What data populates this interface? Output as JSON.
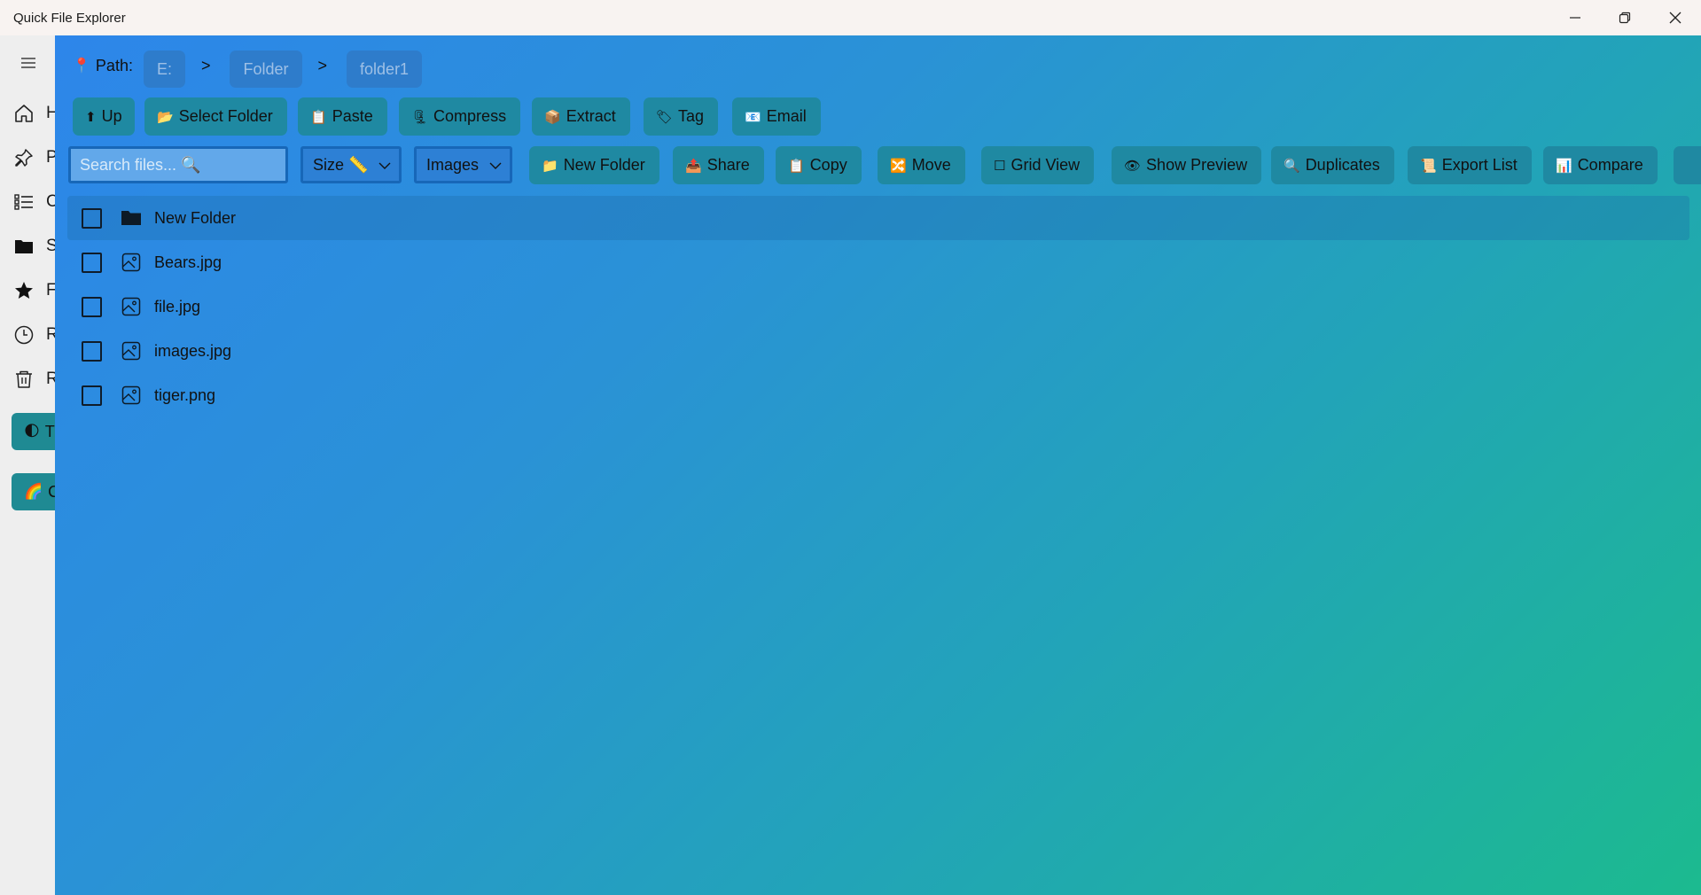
{
  "window": {
    "title": "Quick File Explorer"
  },
  "sidebar": {
    "items": [
      {
        "label": "H",
        "icon": "home-icon"
      },
      {
        "label": "P",
        "icon": "pin-icon"
      },
      {
        "label": "C",
        "icon": "list-icon"
      },
      {
        "label": "S",
        "icon": "folder-icon"
      },
      {
        "label": "F",
        "icon": "star-icon"
      },
      {
        "label": "R",
        "icon": "clock-icon"
      },
      {
        "label": "R",
        "icon": "trash-icon"
      }
    ],
    "pills": [
      {
        "emoji": "🌓",
        "label": "T"
      },
      {
        "emoji": "🌈",
        "label": "C"
      }
    ]
  },
  "path": {
    "pin": "📍",
    "label": "Path:",
    "separator": ">",
    "crumbs": [
      "E:",
      "Folder",
      "folder1"
    ]
  },
  "toolbar1": [
    {
      "icon": "⬆",
      "label": "Up"
    },
    {
      "icon": "📂",
      "label": "Select Folder"
    },
    {
      "icon": "📋",
      "label": "Paste"
    },
    {
      "icon": "🗜",
      "label": "Compress"
    },
    {
      "icon": "📦",
      "label": "Extract"
    },
    {
      "icon": "🏷",
      "label": "Tag"
    },
    {
      "icon": "📧",
      "label": "Email"
    }
  ],
  "search": {
    "placeholder": "Search files... 🔍"
  },
  "sort": {
    "value": "Size 📏"
  },
  "filter": {
    "value": "Images"
  },
  "toolbar2": [
    {
      "icon": "📁",
      "label": "New Folder"
    },
    {
      "icon": "📤",
      "label": "Share"
    },
    {
      "icon": "📋",
      "label": "Copy"
    },
    {
      "icon": "🔀",
      "label": "Move"
    },
    {
      "icon": "☐",
      "label": "Grid View"
    },
    {
      "icon": "👁",
      "label": "Show Preview"
    },
    {
      "icon": "🔍",
      "label": "Duplicates"
    },
    {
      "icon": "📜",
      "label": "Export List"
    },
    {
      "icon": "📊",
      "label": "Compare"
    }
  ],
  "files": [
    {
      "name": "New Folder",
      "type": "folder",
      "selected": true
    },
    {
      "name": "Bears.jpg",
      "type": "image",
      "selected": false
    },
    {
      "name": "file.jpg",
      "type": "image",
      "selected": false
    },
    {
      "name": "images.jpg",
      "type": "image",
      "selected": false
    },
    {
      "name": "tiger.png",
      "type": "image",
      "selected": false
    }
  ],
  "colors": {
    "accent_button": "#1f89a2",
    "gradient_start": "#2d86ea",
    "gradient_end": "#1cba8f",
    "input_border": "#1767b8"
  }
}
